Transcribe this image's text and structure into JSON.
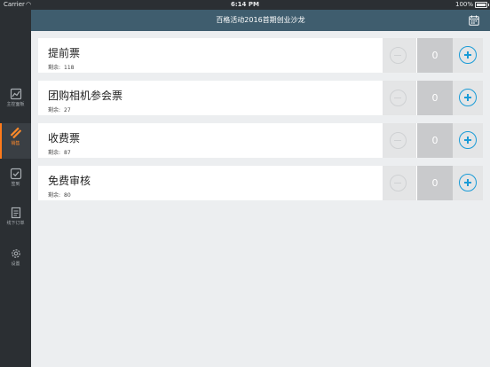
{
  "status_bar": {
    "carrier": "Carrier",
    "time": "6:14 PM",
    "battery": "100%"
  },
  "header": {
    "title": "百格活动2016首期创业沙龙",
    "calendar_icon": "calendar-icon"
  },
  "sidebar": {
    "items": [
      {
        "label": "主控面板",
        "icon": "dashboard-icon"
      },
      {
        "label": "销售",
        "icon": "ticket-icon",
        "active": true
      },
      {
        "label": "签到",
        "icon": "checkbox-icon"
      },
      {
        "label": "线下订单",
        "icon": "receipt-icon"
      },
      {
        "label": "设置",
        "icon": "gear-icon"
      }
    ]
  },
  "tickets": [
    {
      "name": "提前票",
      "remaining_label": "剩余:",
      "remaining": "118",
      "quantity": "0"
    },
    {
      "name": "团购相机参会票",
      "remaining_label": "剩余:",
      "remaining": "27",
      "quantity": "0"
    },
    {
      "name": "收费票",
      "remaining_label": "剩余:",
      "remaining": "87",
      "quantity": "0"
    },
    {
      "name": "免费审核",
      "remaining_label": "剩余:",
      "remaining": "80",
      "quantity": "0"
    }
  ],
  "colors": {
    "accent": "#1a9bd7",
    "active_nav": "#ff8a2a",
    "header_bg": "#3f5d6e",
    "sidebar_bg": "#2b2f33"
  }
}
